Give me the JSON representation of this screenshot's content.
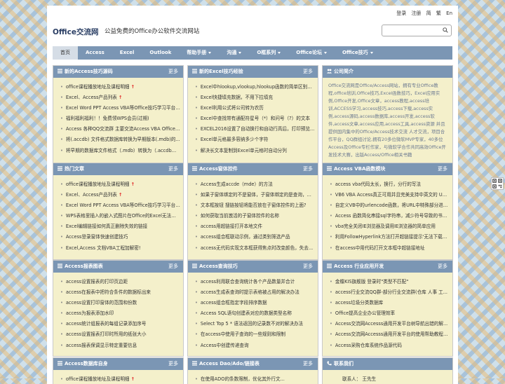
{
  "header": {
    "logo": "Office交流网",
    "slogan": "公益免费的Office办公软件交流网站",
    "top_links": [
      "登录",
      "注册",
      "简",
      "繁",
      "En"
    ],
    "search_placeholder": ""
  },
  "nav": [
    {
      "label": "首页",
      "active": true,
      "dropdown": false
    },
    {
      "label": "Access",
      "dropdown": false
    },
    {
      "label": "Excel",
      "dropdown": false
    },
    {
      "label": "Outlook",
      "dropdown": false
    },
    {
      "label": "帮助手册",
      "dropdown": true
    },
    {
      "label": "沟通",
      "dropdown": true
    },
    {
      "label": "O框系列",
      "dropdown": true
    },
    {
      "label": "Office论坛",
      "dropdown": true
    },
    {
      "label": "Office技巧",
      "dropdown": true
    }
  ],
  "panels": {
    "access_src": {
      "title": "新的Access技巧源码",
      "more": "更多",
      "items": [
        {
          "text": "office课程播放地址及课程明细",
          "hot": true
        },
        {
          "text": "Excel、Access产品列表",
          "hot": true
        },
        {
          "text": "Excel Word PPT Access VBA等Office技巧学习平台",
          "hot": true
        },
        {
          "text": "福利福利福利！！免费领WPS会员(过期)"
        },
        {
          "text": "Access 各种QQ交流群 主要交流Access VBA Office E..."
        },
        {
          "text": "将(.accdb) 文件格式数据库转换为早期版本(.mdb)的..."
        },
        {
          "text": "将早期的数据库文件格式（.mdb）转换为（.accdb）..."
        }
      ]
    },
    "excel_tips": {
      "title": "新的Excel技巧经验",
      "more": "更多",
      "items": [
        {
          "text": "Excel中hlookup,vlookup,hlookup函数的简单区别和应用"
        },
        {
          "text": "Excel快捷填充数据，不用下拉填充"
        },
        {
          "text": "Excel利用公式将公司转为农历"
        },
        {
          "text": "Excel中查找带有通配符星号（*）和问号（?）的文本"
        },
        {
          "text": "EXCEL2016设置了自动换行和自动行高后，打印预览..."
        },
        {
          "text": "Excel单元格最多容纳多少个字符"
        },
        {
          "text": "解决长文本复制到Excel单元格时自动分列"
        }
      ]
    },
    "company": {
      "title": "公司简介",
      "text": "Office交流网是Office/Access网站，拥有专业Office教程,office培训,Office技巧,Excel函数技巧，Excel应用实例,Office开发,Office文章，access教程,access培训,ACCESS学习,access技巧,access下载,access实例,access源码,access数据库,access开发,access软件,access文章,access应用,access工具,access资源 并且提供国内集中的Office/Access技术交流 人才交流，项目合作平台，QQ群组讨论,拥有20多位微软MVP专家，40多位Access及Office专栏作家，与微软学合作共同高效Office开发技术大赛，出版Access/Office相关书籍"
    },
    "hot_articles": {
      "title": "热门文章",
      "more": "更多",
      "items": [
        {
          "text": "office课程播放地址及课程明细",
          "hot": true
        },
        {
          "text": "Excel、Access产品列表",
          "hot": true
        },
        {
          "text": "Excel Word PPT Access VBA等Office技巧学习平台",
          "hot": true
        },
        {
          "text": "WPS表格里插入的嵌入式图片在Office的Excel无法正..."
        },
        {
          "text": "Excel编辑链接如何真正删除失效的链接"
        },
        {
          "text": "Access登录窗体快速创建技巧"
        },
        {
          "text": "Excel,Access 文档VBA工程加解密!"
        }
      ]
    },
    "access_forms": {
      "title": "Access窗体控件",
      "more": "更多",
      "items": [
        {
          "text": "Access生成accde（mde）的方法"
        },
        {
          "text": "如果子窗体绑定的不是窗体，子窗体绑定的是查询，..."
        },
        {
          "text": "文本框按钮 搜链按钮将能否放在子窗体控件的上面?"
        },
        {
          "text": "如何获取当前激活的子窗体控件的名称"
        },
        {
          "text": "access用超链接打开本地文件"
        },
        {
          "text": "access组合框联动示例，通过类别筛选产品"
        },
        {
          "text": "access无代码实现文本框获得焦点时改变颜色，失去..."
        }
      ]
    },
    "access_vba": {
      "title": "Access VBA函数模块",
      "more": "更多",
      "items": [
        {
          "text": "access vba代码太长，换行，分行的写法"
        },
        {
          "text": "VB6 VBA Access真正可用并且完美支持中英文的 URL..."
        },
        {
          "text": "自定义VB中的urlencode函数，将URL中特殊部分进行..."
        },
        {
          "text": "Access 函数简化串接sql字符串，减少符号导致的书写..."
        },
        {
          "text": "vba完全关闭IE浏览器及调用IE浏览器的简单应用"
        },
        {
          "text": "利用FollowHyperlink方法打开超链接提示'无法下载您..."
        },
        {
          "text": "在access中用代码打开文本框中超链接地址"
        }
      ]
    },
    "access_reports": {
      "title": "Access报表图表",
      "more": "更多",
      "items": [
        {
          "text": "access设置报表的打印页边距"
        },
        {
          "text": "access在报表中把符合条件的数据标出来"
        },
        {
          "text": "access设置打印窗体的范围和份数"
        },
        {
          "text": "access为报表添加水印"
        },
        {
          "text": "access统计组报表的每组记录添加序号"
        },
        {
          "text": "access设置报表打印时所用的纸张大小"
        },
        {
          "text": "access报表保调显示特定重要信息"
        }
      ]
    },
    "access_query": {
      "title": "Access查询技巧",
      "more": "更多",
      "items": [
        {
          "text": "access利用联合查询统计各个产品数量并合计"
        },
        {
          "text": "access生成表查询时提示表格被占用的解决办法"
        },
        {
          "text": "access组合框指定字段排序数据"
        },
        {
          "text": "Access SQL语句创建表对应的数据类型名称"
        },
        {
          "text": "Select Top 5 * 语法返回的记录数不对的解决办法"
        },
        {
          "text": "在access中使用子查询的一些规则和限制"
        },
        {
          "text": "Access中创建传递查询"
        }
      ]
    },
    "access_industry": {
      "title": "Access 行业应用开发",
      "more": "更多",
      "items": [
        {
          "text": "金蝶KIS旗舰版 登录时\"类型不匹配\""
        },
        {
          "text": "access行业交流QQ群-部分行业交流群(仓库 人事 工..."
        },
        {
          "text": "access垃圾分类数据库"
        },
        {
          "text": "Office提高企业办公管理效率"
        },
        {
          "text": "Access交流网Accesss通用开发平台树导航出错的解..."
        },
        {
          "text": "Access交流网Accesss通用开发平台的使用帮助教程及..."
        },
        {
          "text": "Access采购仓库系统作品源代码"
        }
      ]
    },
    "access_db": {
      "title": "Access数据库自身",
      "more": "更多",
      "items": [
        {
          "text": "office课程播放地址及课程明细",
          "hot": true
        }
      ]
    },
    "access_dao": {
      "title": "Access Dao/Ado/链接表",
      "more": "更多",
      "items": [
        {
          "text": "在使用ADO的条数限制，优化其外行文..."
        }
      ]
    },
    "contact": {
      "title": "联系我们",
      "label": "联系人：",
      "value": "王先生"
    }
  }
}
